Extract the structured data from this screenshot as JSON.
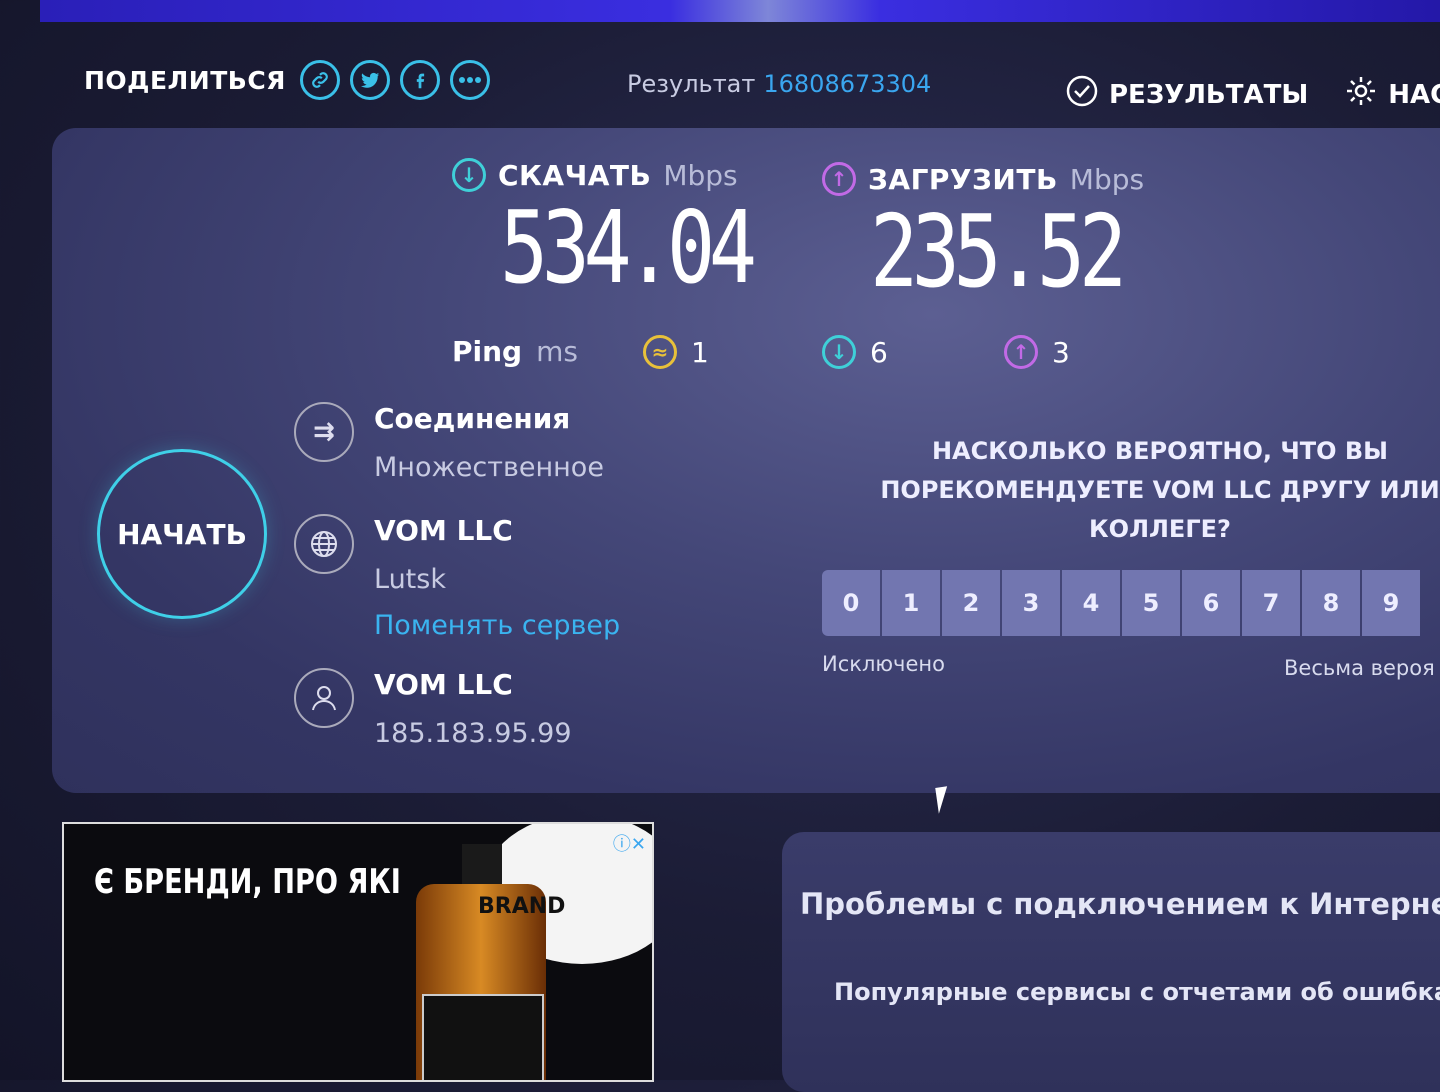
{
  "share": {
    "label": "ПОДЕЛИТЬСЯ"
  },
  "result": {
    "label": "Результат",
    "id": "16808673304"
  },
  "nav": {
    "results": "РЕЗУЛЬТАТЫ",
    "settings": "НАСТ"
  },
  "download": {
    "label": "СКАЧАТЬ",
    "unit": "Mbps",
    "value": "534.04"
  },
  "upload": {
    "label": "ЗАГРУЗИТЬ",
    "unit": "Mbps",
    "value": "235.52"
  },
  "ping": {
    "label": "Ping",
    "unit": "ms",
    "idle": "1",
    "download": "6",
    "upload": "3"
  },
  "start_button": "НАЧАТЬ",
  "connections": {
    "title": "Соединения",
    "value": "Множественное"
  },
  "server": {
    "name": "VOM LLC",
    "city": "Lutsk",
    "change_link": "Поменять сервер"
  },
  "provider": {
    "name": "VOM LLC",
    "ip": "185.183.95.99"
  },
  "survey": {
    "question": "НАСКОЛЬКО ВЕРОЯТНО, ЧТО ВЫ ПОРЕКОМЕНДУЕТЕ VOM LLC ДРУГУ ИЛИ КОЛЛЕГЕ?",
    "scale": [
      "0",
      "1",
      "2",
      "3",
      "4",
      "5",
      "6",
      "7",
      "8",
      "9"
    ],
    "low_label": "Исключено",
    "high_label": "Весьма вероя"
  },
  "ad": {
    "headline": "Є БРЕНДИ, ПРО ЯКІ",
    "brand": "BRAND"
  },
  "help": {
    "title": "Проблемы с подключением к Интернет?",
    "subtitle": "Популярные сервисы с отчетами об ошибках"
  }
}
